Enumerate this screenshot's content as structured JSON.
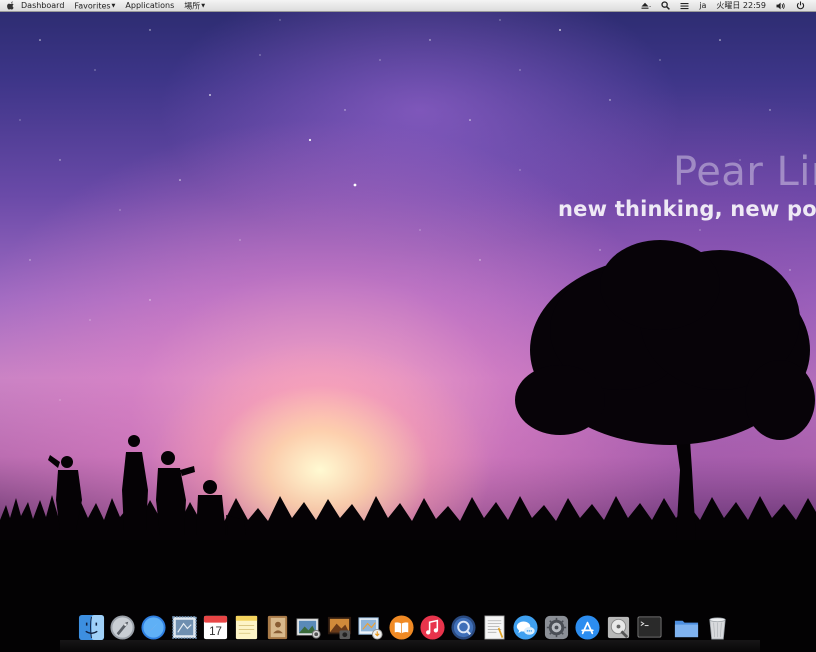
{
  "menubar": {
    "apple_menu": "apple-logo-icon",
    "items": [
      {
        "label": "Dashboard",
        "dropdown": false
      },
      {
        "label": "Favorites",
        "dropdown": true
      },
      {
        "label": "Applications",
        "dropdown": false
      },
      {
        "label": "場所",
        "dropdown": true
      }
    ],
    "status": {
      "eject_icon": "eject-icon",
      "search_icon": "search-icon",
      "menu_icon": "list-icon",
      "input_method": "ja",
      "clock": "火曜日 22:59",
      "volume_icon": "volume-icon",
      "power_icon": "power-icon"
    }
  },
  "wallpaper": {
    "title": "Pear Lin",
    "tagline": "new thinking, new pos"
  },
  "dock": {
    "items": [
      {
        "name": "finder-icon",
        "color": "#3d8fe0"
      },
      {
        "name": "launchpad-rocket-icon",
        "color": "#9aa0a8"
      },
      {
        "name": "safari-compass-icon",
        "color": "#2f7fe0"
      },
      {
        "name": "mail-stamp-icon",
        "color": "#6f8fb0"
      },
      {
        "name": "calendar-icon",
        "color": "#e84545",
        "label": "17"
      },
      {
        "name": "notes-icon",
        "color": "#f4d35e"
      },
      {
        "name": "contacts-book-icon",
        "color": "#a87a48"
      },
      {
        "name": "preview-photos-icon",
        "color": "#5a8ab8"
      },
      {
        "name": "photo-booth-icon",
        "color": "#d08a3a"
      },
      {
        "name": "image-capture-icon",
        "color": "#8fb4d8"
      },
      {
        "name": "ibooks-icon",
        "color": "#f08a24"
      },
      {
        "name": "itunes-music-icon",
        "color": "#e8344c"
      },
      {
        "name": "quicktime-icon",
        "color": "#3f6fb8"
      },
      {
        "name": "textedit-icon",
        "color": "#c9c9c9"
      },
      {
        "name": "messages-icon",
        "color": "#3fa0f0"
      },
      {
        "name": "system-preferences-icon",
        "color": "#8b8f96"
      },
      {
        "name": "app-store-icon",
        "color": "#2c8df0"
      },
      {
        "name": "disk-utility-icon",
        "color": "#b8b8b8"
      },
      {
        "name": "terminal-icon",
        "color": "#2a2a2a"
      },
      {
        "name": "folder-stack-icon",
        "color": "#4d8fe0"
      },
      {
        "name": "trash-icon",
        "color": "#d8dadd"
      }
    ]
  }
}
